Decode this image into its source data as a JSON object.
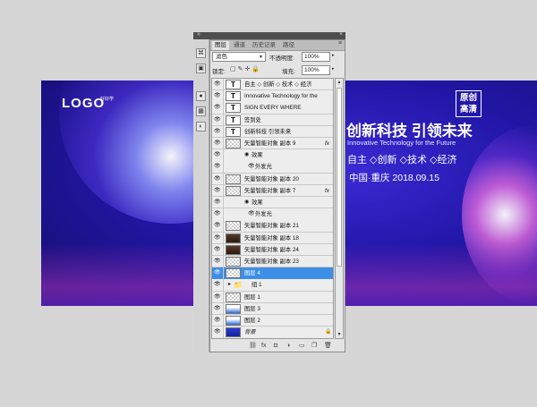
{
  "poster": {
    "logo": "LOGO",
    "logo_sub": "好好学",
    "title": "创新科技 引领未来",
    "subtitle": "Innovative Technology for the Future",
    "tags": "自主 ◇创新 ◇技术 ◇经济",
    "location_date": "中国·重庆    2018.09.15",
    "badge_line1": "原创",
    "badge_line2": "高清"
  },
  "panel": {
    "title_arrows": "»",
    "close": "×",
    "tabs": [
      {
        "label": "图层"
      },
      {
        "label": "通道"
      },
      {
        "label": "历史记录"
      },
      {
        "label": "路径"
      }
    ],
    "menu_icon": "≡",
    "blend_mode": "滤色",
    "opacity_label": "不透明度:",
    "opacity_value": "100%",
    "lock_label": "锁定:",
    "fill_label": "填充:",
    "fill_value": "100%"
  },
  "layers": [
    {
      "name": "自主 ◇ 创新 ◇ 技术 ◇ 经济",
      "thumb": "t"
    },
    {
      "name": "Innovative Technology for the Fu",
      "thumb": "t"
    },
    {
      "name": "SIGN EVERY WHERE",
      "thumb": "t"
    },
    {
      "name": "签到处",
      "thumb": "t"
    },
    {
      "name": "创新科技  引领未来",
      "thumb": "t"
    },
    {
      "name": "矢量智能对象 副本 9",
      "thumb": "chk",
      "fx": "fx"
    },
    {
      "name": "效果",
      "sub": 1
    },
    {
      "name": "外发光",
      "sub": 2
    },
    {
      "name": "矢量智能对象 副本 20",
      "thumb": "chk"
    },
    {
      "name": "矢量智能对象 副本 7",
      "thumb": "chk",
      "fx": "fx"
    },
    {
      "name": "效果",
      "sub": 1
    },
    {
      "name": "外发光",
      "sub": 2
    },
    {
      "name": "矢量智能对象 副本 21",
      "thumb": "chk"
    },
    {
      "name": "矢量智能对象 副本 18",
      "thumb": "dark"
    },
    {
      "name": "矢量智能对象 副本 24",
      "thumb": "dark"
    },
    {
      "name": "矢量智能对象 副本 23",
      "thumb": "chk"
    },
    {
      "name": "图层 4",
      "thumb": "chk",
      "selected": true
    },
    {
      "name": "组 1",
      "thumb": "folder"
    },
    {
      "name": "图层 1",
      "thumb": "chk"
    },
    {
      "name": "图层 3",
      "thumb": "bluemix"
    },
    {
      "name": "图层 2",
      "thumb": "bluemix"
    },
    {
      "name": "背景",
      "thumb": "blue",
      "locked": true
    }
  ],
  "bottom_icons": [
    "⛓",
    "fx",
    "◘",
    "◑",
    "▭",
    "❐",
    "🗑"
  ]
}
